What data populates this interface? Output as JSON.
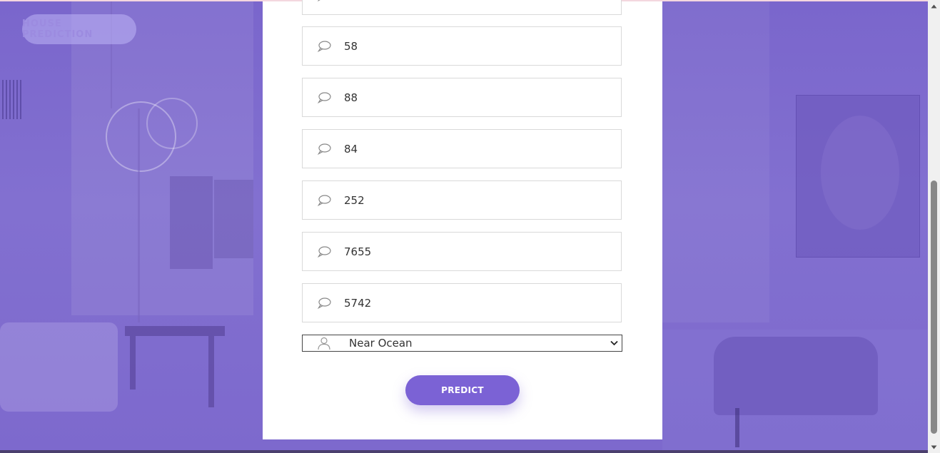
{
  "brand": {
    "label": "HOUSE PREDICTION"
  },
  "form": {
    "fields": [
      {
        "value": ""
      },
      {
        "value": "58"
      },
      {
        "value": "88"
      },
      {
        "value": "84"
      },
      {
        "value": "252"
      },
      {
        "value": "7655"
      },
      {
        "value": "5742"
      }
    ],
    "ocean_proximity": {
      "selected": "Near Ocean"
    },
    "predict_label": "PREDICT"
  },
  "icons": {
    "field_icon": "speech-bubble-icon",
    "select_icon": "user-icon",
    "dropdown_icon": "chevron-down-icon"
  },
  "colors": {
    "accent": "#7b62d5",
    "background_tint": "#7a66cc",
    "brand_pill": "#bfb4f5"
  }
}
